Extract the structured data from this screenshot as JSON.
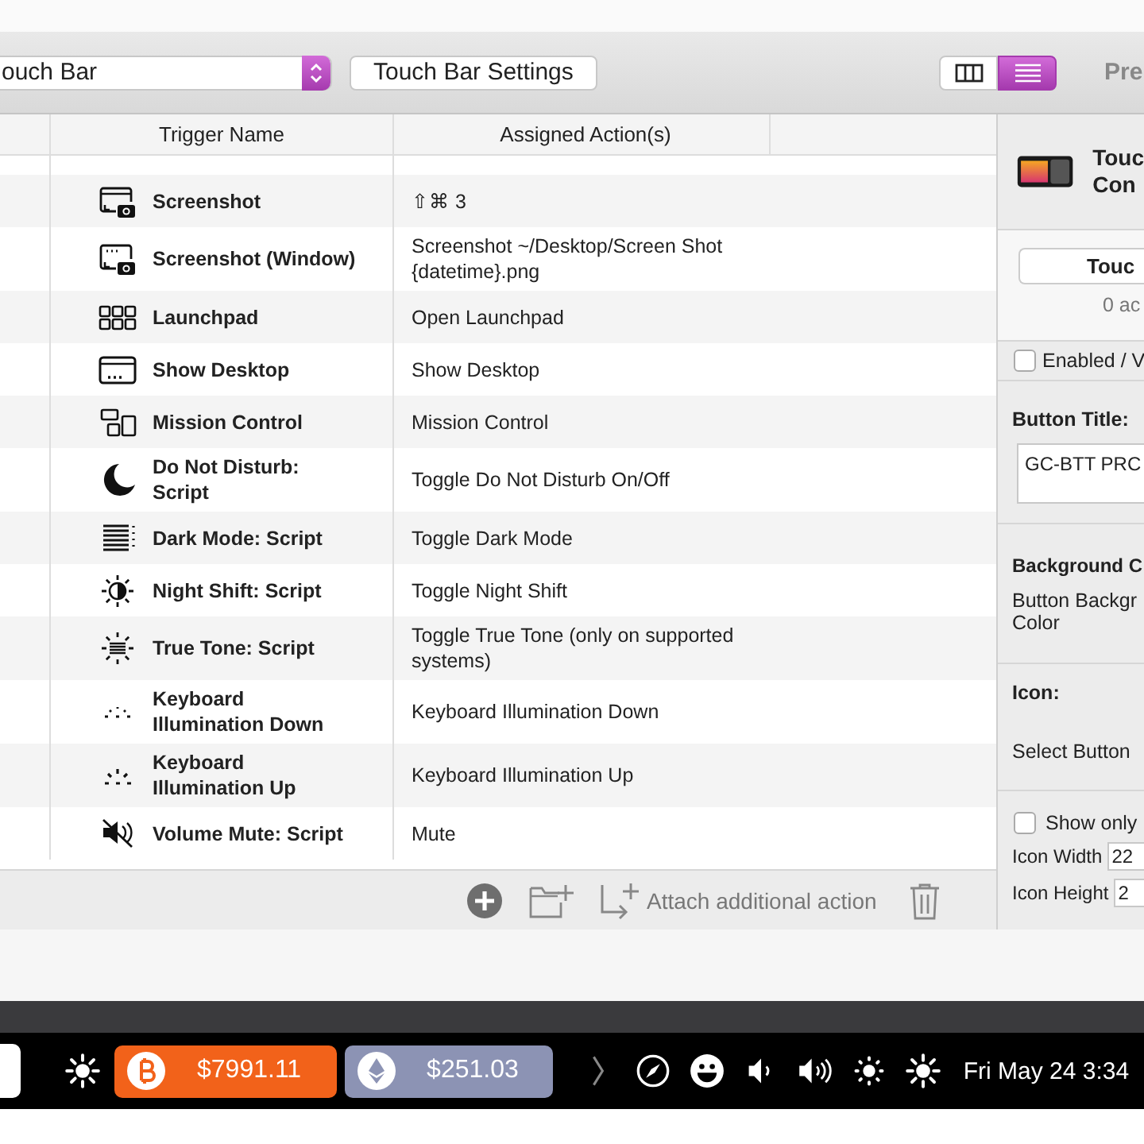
{
  "toolbar": {
    "dropdown": {
      "value": "ouch Bar"
    },
    "settings_button": "Touch Bar Settings",
    "view_modes": [
      {
        "kind": "columns",
        "selected": false
      },
      {
        "kind": "list",
        "selected": true
      }
    ],
    "cut_tab": "Pre"
  },
  "table": {
    "columns": [
      "Trigger Name",
      "Assigned Action(s)"
    ],
    "rows": [
      {
        "name": "Screenshot",
        "action": "⇧⌘ 3"
      },
      {
        "name": "Screenshot (Window)",
        "action": "Screenshot ~/Desktop/Screen Shot {datetime}.png"
      },
      {
        "name": "Launchpad",
        "action": "Open Launchpad"
      },
      {
        "name": "Show Desktop",
        "action": "Show Desktop"
      },
      {
        "name": "Mission Control",
        "action": "Mission Control"
      },
      {
        "name": "Do Not Disturb: Script",
        "action": "Toggle Do Not Disturb On/Off"
      },
      {
        "name": "Dark Mode: Script",
        "action": "Toggle Dark Mode"
      },
      {
        "name": "Night Shift: Script",
        "action": "Toggle Night Shift"
      },
      {
        "name": "True Tone: Script",
        "action": "Toggle True Tone (only on supported systems)"
      },
      {
        "name": "Keyboard Illumination Down",
        "action": "Keyboard Illumination Down"
      },
      {
        "name": "Keyboard Illumination Up",
        "action": "Keyboard Illumination Up"
      },
      {
        "name": "Volume Mute: Script",
        "action": "Mute"
      }
    ]
  },
  "footer": {
    "attach_label": "Attach additional action"
  },
  "inspector": {
    "title_lines": [
      "Touc",
      "Con"
    ],
    "button": "Touc",
    "count": "0 ac",
    "enabled": {
      "label": "Enabled / V",
      "checked": false
    },
    "button_title_label": "Button Title:",
    "button_title_value": "GC-BTT PRC",
    "background_label": "Background C",
    "background_text": [
      "Button Backgr",
      "Color"
    ],
    "icon_label": "Icon:",
    "select_icon": "Select Button",
    "show_only": {
      "label": "Show only",
      "checked": false
    },
    "icon_width": {
      "label": "Icon Width",
      "value": "22"
    },
    "icon_height": {
      "label": "Icon Height",
      "value": "2"
    }
  },
  "touch_bar": {
    "items": [
      {
        "kind": "key"
      },
      {
        "kind": "icon"
      },
      {
        "kind": "ticker",
        "price": "$7991.11",
        "color": "#f2621a"
      },
      {
        "kind": "ticker",
        "price": "$251.03",
        "color": "#8c93b4"
      },
      {
        "kind": "icon"
      },
      {
        "kind": "icon"
      },
      {
        "kind": "icon"
      },
      {
        "kind": "icon"
      },
      {
        "kind": "icon"
      },
      {
        "kind": "icon"
      },
      {
        "kind": "icon"
      },
      {
        "kind": "clock",
        "text": "Fri May 24 3:34"
      }
    ]
  }
}
